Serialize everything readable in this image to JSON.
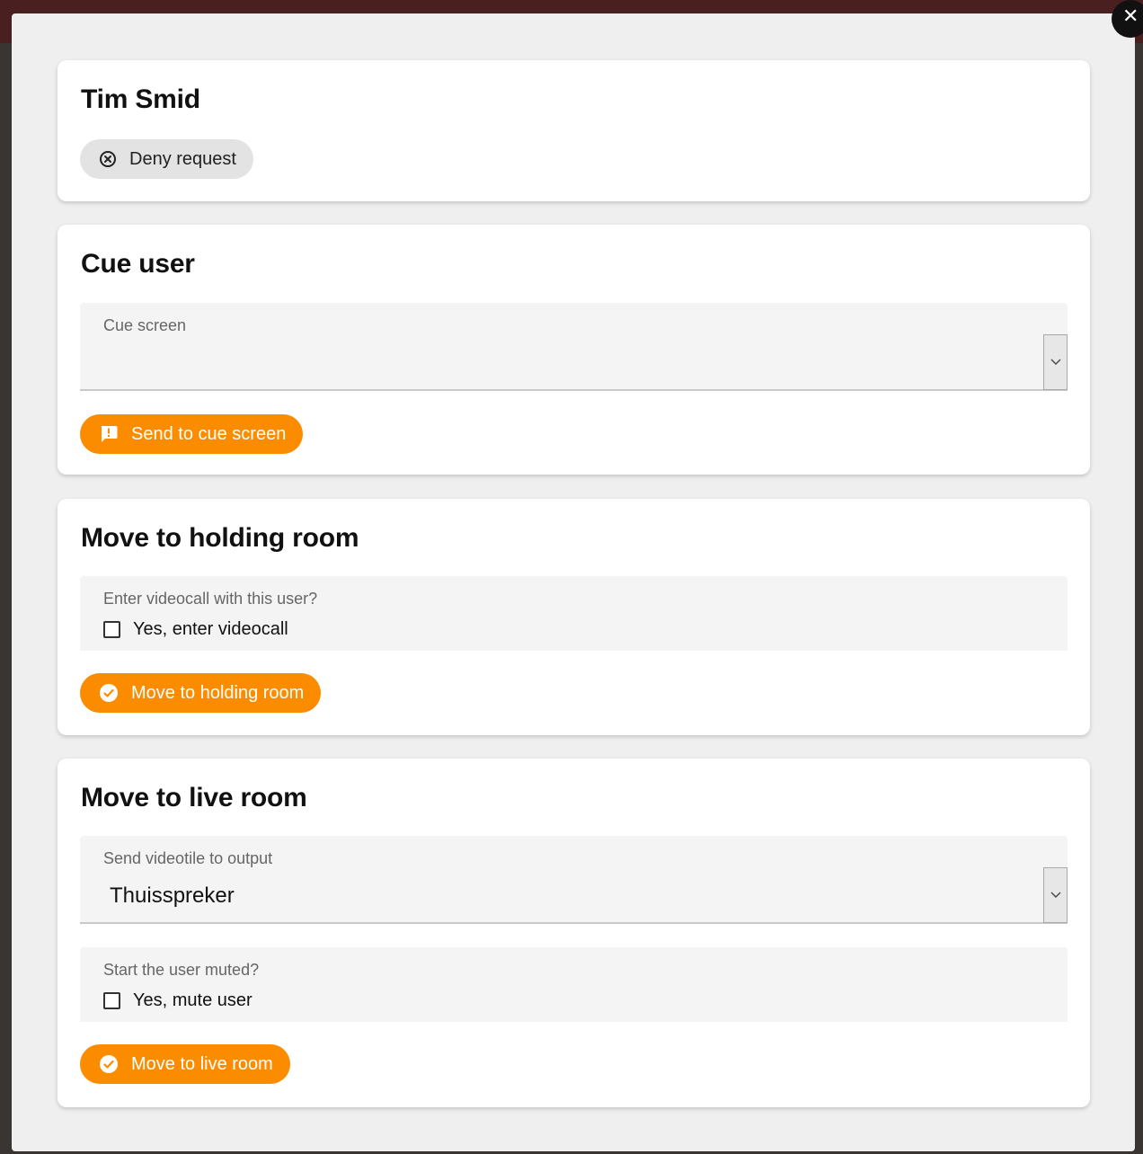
{
  "close_label": "✕",
  "cards": {
    "user": {
      "title": "Tim Smid",
      "deny_label": "Deny request"
    },
    "cue": {
      "title": "Cue user",
      "field_label": "Cue screen",
      "field_value": "",
      "button_label": "Send to cue screen"
    },
    "holding": {
      "title": "Move to holding room",
      "field_label": "Enter videocall with this user?",
      "checkbox_label": "Yes, enter videocall",
      "checkbox_checked": false,
      "button_label": "Move to holding room"
    },
    "live": {
      "title": "Move to live room",
      "output_label": "Send videotile to output",
      "output_value": "Thuisspreker",
      "mute_label": "Start the user muted?",
      "mute_checkbox_label": "Yes, mute user",
      "mute_checked": false,
      "button_label": "Move to live room"
    }
  },
  "colors": {
    "accent": "#fb8c00",
    "card_bg": "#ffffff",
    "modal_bg": "#efefef",
    "field_bg": "#f4f4f4",
    "deny_bg": "#e3e3e3"
  }
}
